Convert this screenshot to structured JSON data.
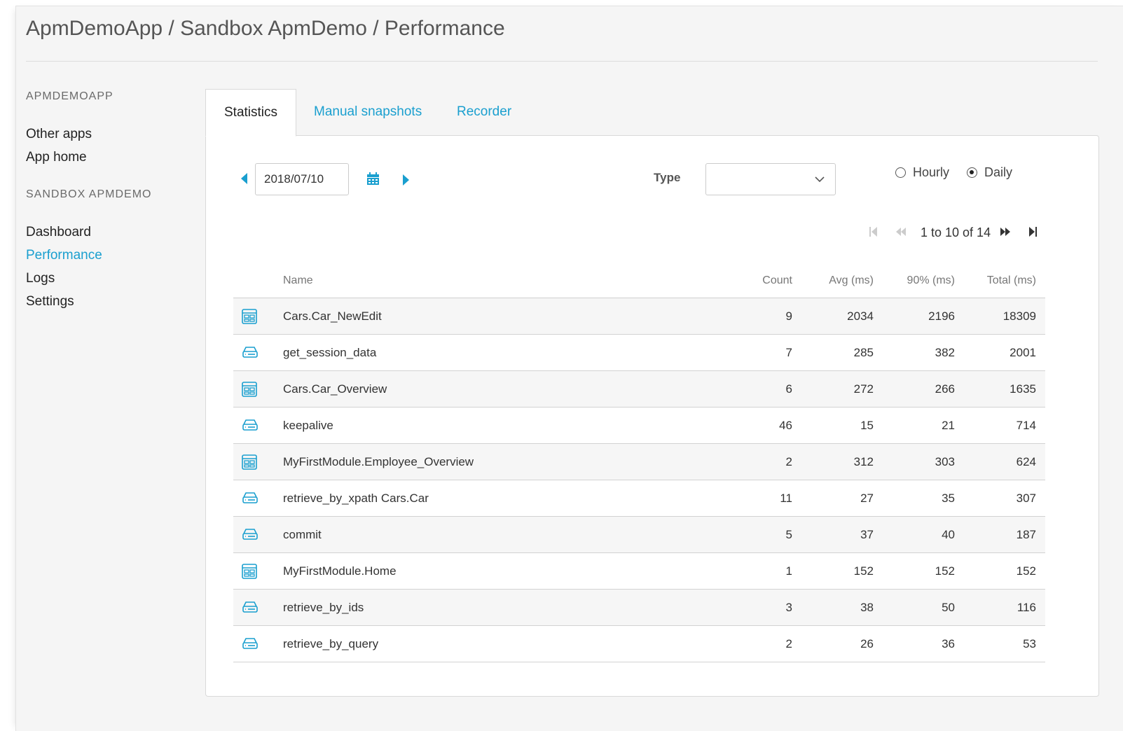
{
  "header": {
    "breadcrumb": "ApmDemoApp / Sandbox ApmDemo / Performance"
  },
  "sidebar": {
    "sections": [
      {
        "heading": "APMDEMOAPP",
        "items": [
          {
            "label": "Other apps"
          },
          {
            "label": "App home"
          }
        ]
      },
      {
        "heading": "SANDBOX APMDEMO",
        "items": [
          {
            "label": "Dashboard"
          },
          {
            "label": "Performance",
            "active": true
          },
          {
            "label": "Logs"
          },
          {
            "label": "Settings"
          }
        ]
      }
    ]
  },
  "tabs": [
    {
      "label": "Statistics",
      "active": true
    },
    {
      "label": "Manual snapshots"
    },
    {
      "label": "Recorder"
    }
  ],
  "toolbar": {
    "date_value": "2018/07/10",
    "type_label": "Type",
    "type_value": "",
    "period_options": [
      {
        "label": "Hourly",
        "checked": false
      },
      {
        "label": "Daily",
        "checked": true
      }
    ]
  },
  "pager": {
    "text": "1 to 10 of 14"
  },
  "table": {
    "columns": {
      "name": "Name",
      "count": "Count",
      "avg": "Avg (ms)",
      "p90": "90% (ms)",
      "total": "Total (ms)"
    },
    "rows": [
      {
        "icon": "page-icon",
        "name": "Cars.Car_NewEdit",
        "count": "9",
        "avg": "2034",
        "p90": "2196",
        "total": "18309"
      },
      {
        "icon": "database-icon",
        "name": "get_session_data",
        "count": "7",
        "avg": "285",
        "p90": "382",
        "total": "2001"
      },
      {
        "icon": "page-icon",
        "name": "Cars.Car_Overview",
        "count": "6",
        "avg": "272",
        "p90": "266",
        "total": "1635"
      },
      {
        "icon": "database-icon",
        "name": "keepalive",
        "count": "46",
        "avg": "15",
        "p90": "21",
        "total": "714"
      },
      {
        "icon": "page-icon",
        "name": "MyFirstModule.Employee_Overview",
        "count": "2",
        "avg": "312",
        "p90": "303",
        "total": "624"
      },
      {
        "icon": "database-icon",
        "name": "retrieve_by_xpath Cars.Car",
        "count": "11",
        "avg": "27",
        "p90": "35",
        "total": "307"
      },
      {
        "icon": "database-icon",
        "name": "commit",
        "count": "5",
        "avg": "37",
        "p90": "40",
        "total": "187"
      },
      {
        "icon": "page-icon",
        "name": "MyFirstModule.Home",
        "count": "1",
        "avg": "152",
        "p90": "152",
        "total": "152"
      },
      {
        "icon": "database-icon",
        "name": "retrieve_by_ids",
        "count": "3",
        "avg": "38",
        "p90": "50",
        "total": "116"
      },
      {
        "icon": "database-icon",
        "name": "retrieve_by_query",
        "count": "2",
        "avg": "26",
        "p90": "36",
        "total": "53"
      }
    ]
  },
  "colors": {
    "accent": "#1a9fcf",
    "text": "#333333",
    "row_alt": "#f6f6f6"
  }
}
